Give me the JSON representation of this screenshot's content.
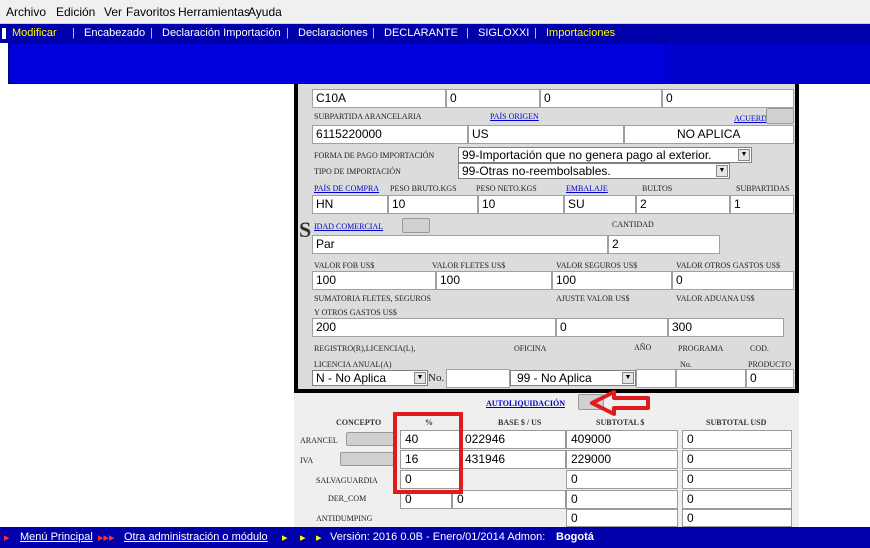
{
  "menu": {
    "archivo": "Archivo",
    "edicion": "Edición",
    "ver": "Ver",
    "favoritos": "Favoritos",
    "herramientas": "Herramientas",
    "ayuda": "Ayuda"
  },
  "nav": {
    "modificar": "Modificar",
    "encabezado": "Encabezado",
    "declaracion_importacion": "Declaración Importación",
    "declaraciones": "Declaraciones",
    "declarante": "DECLARANTE",
    "sigloxxi": "SIGLOXXI",
    "importaciones": "Importaciones",
    "separator": "|"
  },
  "form": {
    "row_c10a": {
      "code": "C10A",
      "v1": "0",
      "v2": "0",
      "v3": "0"
    },
    "subpartida_label": "SUBPARTIDA ARANCELARIA",
    "pais_origen_label": "PAÍS ORIGEN",
    "acuerdo_label": "ACUERDO",
    "subpartida_value": "6115220000",
    "pais_origen_value": "US",
    "acuerdo_value": "NO APLICA",
    "forma_pago_label": "FORMA DE PAGO IMPORTACIÓN",
    "forma_pago_value": "99-Importación que no genera pago al exterior.",
    "tipo_importacion_label": "TIPO DE IMPORTACIÓN",
    "tipo_importacion_value": "99-Otras no-reembolsables.",
    "pais_compra_label": "PAÍS DE COMPRA",
    "peso_bruto_label": "PESO BRUTO.KGS",
    "peso_neto_label": "PESO NETO.KGS",
    "embalaje_label": "EMBALAJE",
    "bultos_label": "BULTOS",
    "subpartidas_label": "SUBPARTIDAS",
    "pais_compra_value": "HN",
    "peso_bruto_value": "10",
    "peso_neto_value": "10",
    "embalaje_value": "SU",
    "bultos_value": "2",
    "subpartidas_value": "1",
    "unidad_comercial_label": "IDAD COMERCIAL",
    "cantidad_label": "CANTIDAD",
    "unidad_comercial_value": "Par",
    "cantidad_value": "2",
    "valor_fob_label": "VALOR FOB US$",
    "valor_fletes_label": "VALOR FLETES US$",
    "valor_seguros_label": "VALOR SEGUROS US$",
    "valor_otros_label": "VALOR OTROS GASTOS US$",
    "valor_fob_value": "100",
    "valor_fletes_value": "100",
    "valor_seguros_value": "100",
    "valor_otros_value": "0",
    "sumatoria_label_1": "SUMATORIA FLETES, SEGUROS",
    "sumatoria_label_2": "Y OTROS GASTOS US$",
    "ajuste_label": "AJUSTE VALOR US$",
    "valor_aduana_label": "VALOR ADUANA US$",
    "sumatoria_value": "200",
    "ajuste_value": "0",
    "valor_aduana_value": "300",
    "registro_label_1": "REGISTRO(R),LICENCIA(L),",
    "registro_label_2": "LICENCIA ANUAL(A)",
    "oficina_label": "OFICINA",
    "anio_label": "AÑO",
    "programa_label": "PROGRAMA",
    "no_label": "No.",
    "cod_label": "COD.",
    "producto_label": "PRODUCTO",
    "registro_value": "N - No Aplica",
    "no_text": "No.",
    "oficina_value": "99 - No Aplica",
    "producto_value": "0",
    "big_letter": "S"
  },
  "liquidacion": {
    "autoliquidacion_label": "AUTOLIQUIDACIÓN",
    "headers": {
      "concepto": "CONCEPTO",
      "pct": "%",
      "base": "BASE $ / US",
      "subtotal": "SUBTOTAL $",
      "subtotal_usd": "SUBTOTAL USD"
    },
    "rows": [
      {
        "concepto": "ARANCEL",
        "pct": "40",
        "base": "022946",
        "subtotal": "409000",
        "usd": "0"
      },
      {
        "concepto": "IVA",
        "pct": "16",
        "base": "431946",
        "subtotal": "229000",
        "usd": "0"
      },
      {
        "concepto": "SALVAGUARDIA",
        "pct": "0",
        "base": "",
        "subtotal": "0",
        "usd": "0"
      },
      {
        "concepto": "DER_COM",
        "pct": "0",
        "base": "0",
        "subtotal": "0",
        "usd": "0"
      },
      {
        "concepto": "ANTIDUMPING",
        "pct": "",
        "base": "",
        "subtotal": "0",
        "usd": "0"
      }
    ]
  },
  "footer": {
    "menu_principal": "Menú Principal",
    "otra_admin": "Otra administración o módulo",
    "version_text": "Versión: 2016 0.0B - Enero/01/2014 Admon:",
    "admon_value": "Bogotá"
  },
  "colors": {
    "nav_bg": "#0000aa",
    "highlight_red": "#e11b1b",
    "link_blue": "#0000cc"
  }
}
